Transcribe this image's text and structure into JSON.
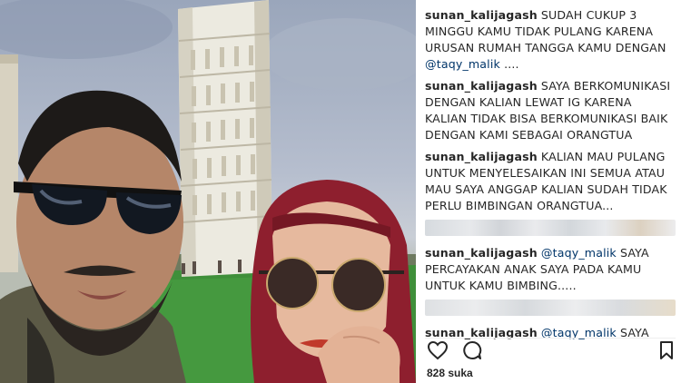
{
  "comments": [
    {
      "user": "sunan_kalijagash",
      "text": "SUDAH CUKUP 3 MINGGU KAMU TIDAK PULANG KARENA URUSAN RUMAH TANGGA KAMU DENGAN",
      "mention": "@taqy_malik",
      "tail": " ...."
    },
    {
      "user": "sunan_kalijagash",
      "text": "SAYA BERKOMUNIKASI DENGAN KALIAN LEWAT IG KARENA KALIAN TIDAK BISA BERKOMUNIKASI BAIK DENGAN KAMI SEBAGAI ORANGTUA",
      "mention": "",
      "tail": ""
    },
    {
      "user": "sunan_kalijagash",
      "text": "KALIAN MAU PULANG UNTUK MENYELESAIKAN INI SEMUA ATAU MAU SAYA ANGGAP KALIAN SUDAH TIDAK PERLU BIMBINGAN ORANGTUA...",
      "mention": "",
      "tail": ""
    },
    {
      "user": "sunan_kalijagash",
      "text": "",
      "mention": "@taqy_malik",
      "tail": " SAYA PERCAYAKAN ANAK SAYA PADA KAMU UNTUK KAMU BIMBING....."
    },
    {
      "user": "sunan_kalijagash",
      "text": "",
      "mention": "@taqy_malik",
      "tail": " SAYA"
    }
  ],
  "actions": {
    "like_icon": "heart-icon",
    "comment_icon": "comment-bubble-icon",
    "save_icon": "bookmark-icon"
  },
  "likes_text": "828 suka",
  "colors": {
    "mention": "#003569",
    "text": "#262626",
    "hijab": "#8e1f2e",
    "grass": "#3f8f3a",
    "tower": "#eceae0"
  }
}
